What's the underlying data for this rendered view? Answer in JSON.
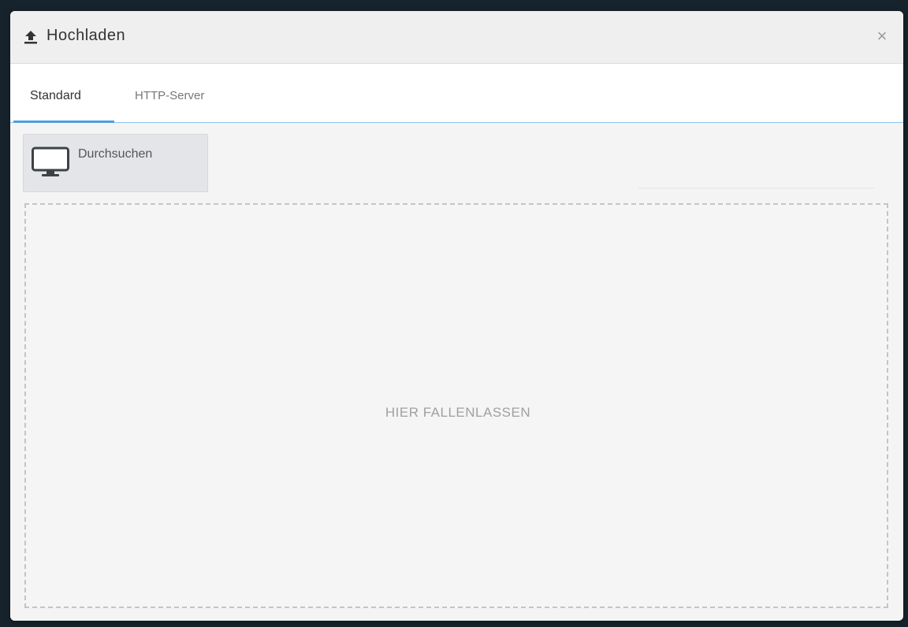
{
  "dialog": {
    "title": "Hochladen",
    "title_icon": "upload-icon",
    "close_label": "×",
    "close_icon": "close-icon"
  },
  "tabs": [
    {
      "label": "Standard",
      "active": true
    },
    {
      "label": "HTTP-Server",
      "active": false
    }
  ],
  "toolbar": {
    "browse_label": "Durchsuchen",
    "browse_icon": "monitor-icon"
  },
  "dropzone": {
    "label": "HIER FALLENLASSEN"
  },
  "colors": {
    "accent": "#4a9fe0",
    "dialog_bg": "#f4f4f4",
    "title_text": "#333333"
  }
}
